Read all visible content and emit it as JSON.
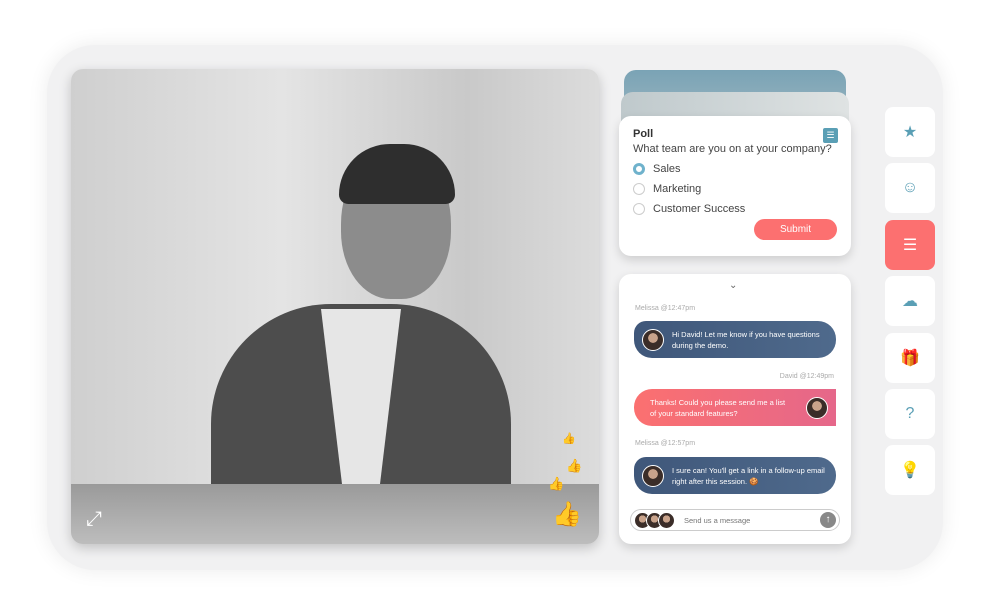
{
  "video": {
    "expand_icon": "expand-icon",
    "reaction_icon": "thumbs-up-icon"
  },
  "poll": {
    "title": "Poll",
    "question": "What team are you on at your company?",
    "options": [
      {
        "label": "Sales",
        "selected": true
      },
      {
        "label": "Marketing",
        "selected": false
      },
      {
        "label": "Customer Success",
        "selected": false
      }
    ],
    "submit_label": "Submit"
  },
  "chat": {
    "messages": [
      {
        "author": "Melissa @12:47pm",
        "text": "Hi David! Let me know if you have questions during the demo."
      },
      {
        "author": "David @12:49pm",
        "text": "Thanks! Could you please send me a list of your standard features?"
      },
      {
        "author": "Melissa @12:57pm",
        "text": "I sure can! You'll get a link in a follow-up email right after this session. 🍪"
      }
    ],
    "placeholder": "Send us a message"
  },
  "sidebar": {
    "items": [
      "star-icon",
      "chat-smile-icon",
      "poll-list-icon",
      "brain-icon",
      "gift-icon",
      "question-icon",
      "lightbulb-icon"
    ],
    "active": "poll-list-icon"
  },
  "colors": {
    "accent": "#fc7070",
    "teal": "#5a9fb5",
    "bubble_in": "#445d80"
  }
}
